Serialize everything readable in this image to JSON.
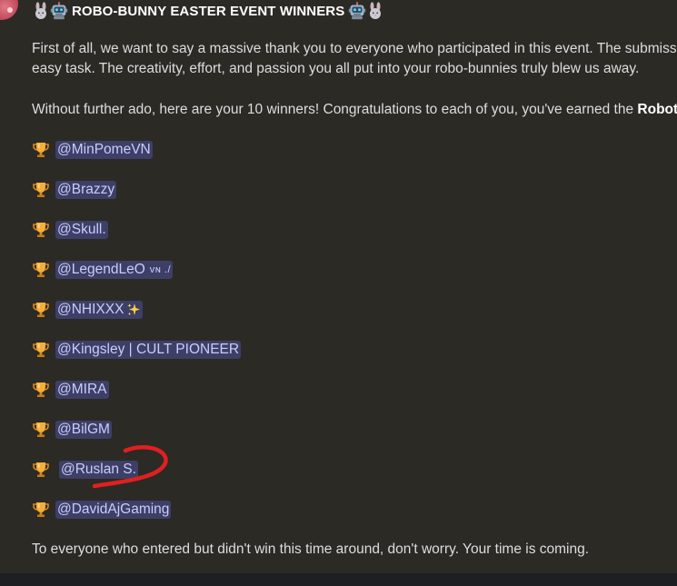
{
  "message": {
    "title": "ROBO-BUNNY EASTER EVENT WINNERS",
    "intro_line1": "First of all, we want to say a massive thank you to everyone who participated in this event. The submission",
    "intro_line2": "easy task. The creativity, effort, and passion you all put into your robo-bunnies truly blew us away.",
    "announce_text": "Without further ado, here are your 10 winners! Congratulations to each of you, you've earned the ",
    "announce_bold": "Robotic",
    "winners": [
      "@MinPomeVN",
      "@Brazzy",
      "@Skull.",
      "@LegendLeO",
      "@NHIXXX",
      "@Kingsley | CULT PIONEER",
      "@MIRA",
      "@BilGM",
      "@Ruslan S.",
      "@DavidAjGaming"
    ],
    "winner4_suffix": "ᴠɴ ./",
    "closing": "To everyone who entered but didn't win this time around, don't worry. Your time is coming."
  },
  "icons": {
    "title_left": [
      "bunny-icon",
      "robot-icon"
    ],
    "title_right": [
      "robot-icon",
      "bunny-icon"
    ],
    "winner_prefix": "trophy-icon",
    "winner5_suffix": "sparkles-icon"
  },
  "colors": {
    "background": "#2b2a25",
    "text": "#dcddde",
    "mention_bg": "#3d3f66",
    "mention_text": "#c9cdfb",
    "trophy": "#f2a33a",
    "annotation": "#e0201f"
  }
}
